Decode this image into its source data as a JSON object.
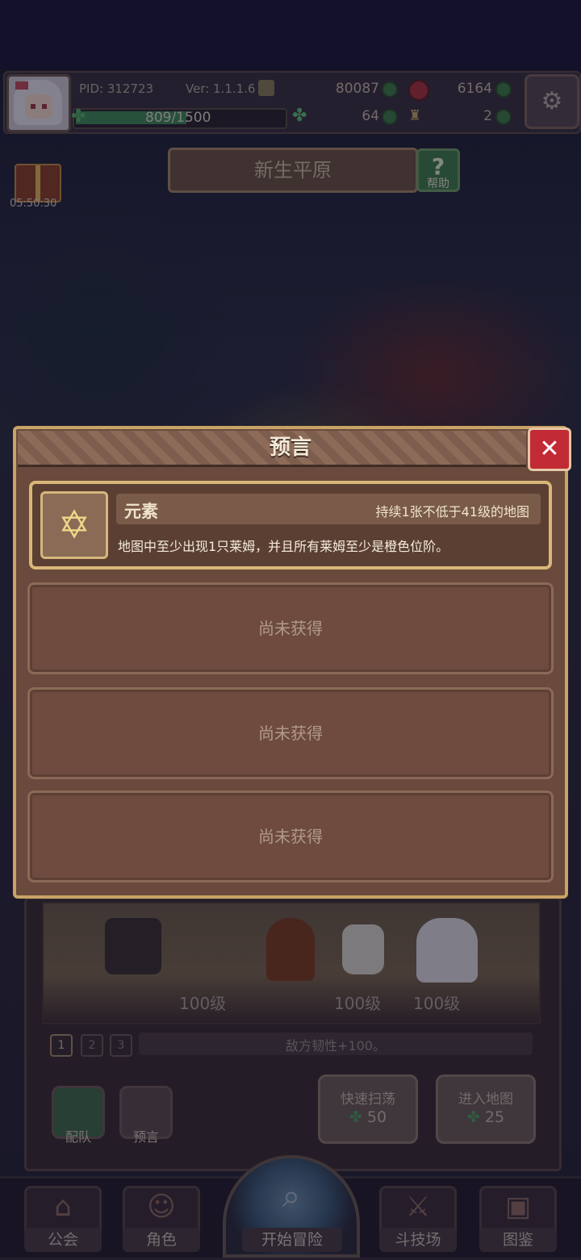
{
  "header": {
    "pid": "PID: 312723",
    "version": "Ver: 1.1.1.6",
    "gold": "80087",
    "gems": "6164",
    "clovers": "64",
    "keys": "2",
    "xp": "809/1500",
    "xp_progress": 0.539
  },
  "map": {
    "title": "新生平原",
    "help_label": "帮助",
    "gift_timer": "05:50:30"
  },
  "prophecy": {
    "title": "预言",
    "slots": [
      {
        "name": "元素",
        "condition": "持续1张不低于41级的地图",
        "description": "地图中至少出现1只莱姆，并且所有莱姆至少是橙色位阶。",
        "icon": "hexagram-icon"
      }
    ],
    "empty_label": "尚未获得"
  },
  "stage": {
    "levels": [
      "100级",
      "100级",
      "100级"
    ],
    "pages": [
      "1",
      "2",
      "3"
    ],
    "effect": "敌方韧性+100。"
  },
  "actions": {
    "team_label": "配队",
    "prophecy_label": "预言",
    "sweep_title": "快速扫荡",
    "sweep_cost": "50",
    "enter_title": "进入地图",
    "enter_cost": "25"
  },
  "nav": {
    "guild": "公会",
    "role": "角色",
    "start": "开始冒险",
    "arena": "斗技场",
    "codex": "图鉴"
  },
  "colors": {
    "panel_bg": "#6a4a3c",
    "panel_border": "#c9a266",
    "close_red": "#c22a35",
    "clover_green": "#4f9c63"
  }
}
